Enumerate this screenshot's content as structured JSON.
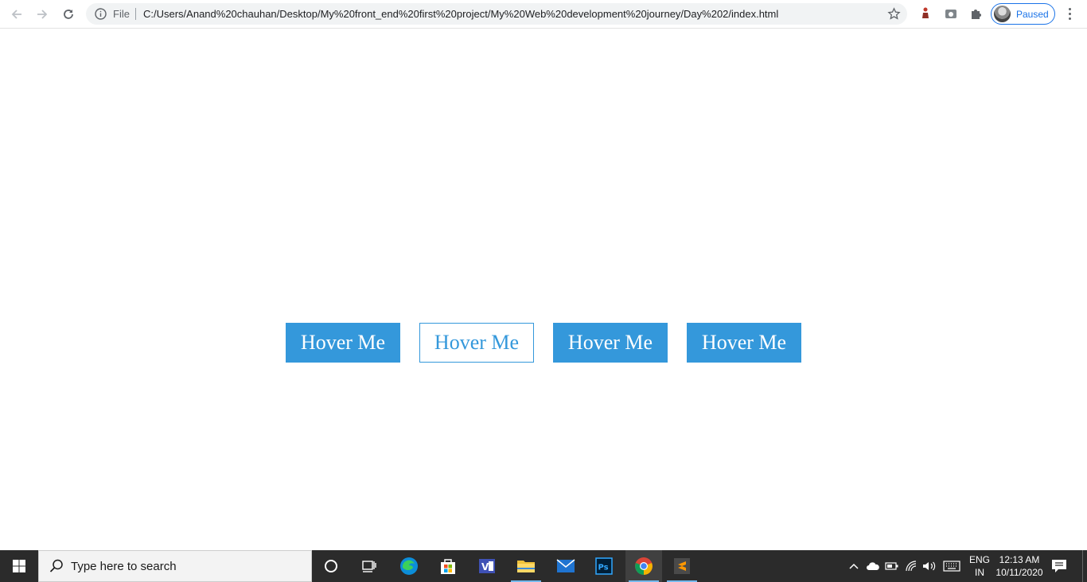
{
  "browser": {
    "address_prefix": "File",
    "url": "C:/Users/Anand%20chauhan/Desktop/My%20front_end%20first%20project/My%20Web%20development%20journey/Day%202/index.html",
    "profile_status": "Paused"
  },
  "page": {
    "buttons": [
      {
        "label": "Hover Me",
        "style": "filled"
      },
      {
        "label": "Hover Me",
        "style": "outline"
      },
      {
        "label": "Hover Me",
        "style": "filled"
      },
      {
        "label": "Hover Me",
        "style": "filled"
      }
    ],
    "accent_color": "#3498db"
  },
  "taskbar": {
    "search_placeholder": "Type here to search",
    "language_line1": "ENG",
    "language_line2": "IN",
    "time": "12:13 AM",
    "date": "10/11/2020",
    "apps": [
      "cortana-icon",
      "task-view-icon",
      "edge-icon",
      "store-icon",
      "visual-studio-icon",
      "file-explorer-icon",
      "mail-icon",
      "photoshop-icon",
      "chrome-icon",
      "sublime-text-icon"
    ]
  }
}
